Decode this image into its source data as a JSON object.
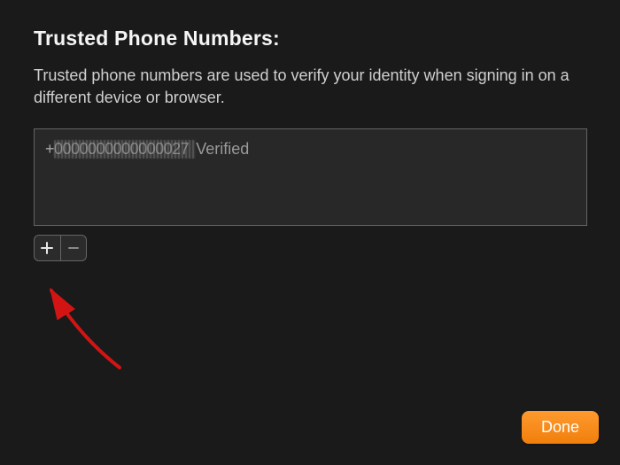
{
  "title": "Trusted Phone Numbers:",
  "description": "Trusted phone numbers are used to verify your identity when signing in on a different device or browser.",
  "phones": [
    {
      "masked_number": "+0000000000000027",
      "status": "Verified"
    }
  ],
  "buttons": {
    "add_label": "+",
    "remove_label": "−",
    "done_label": "Done"
  },
  "colors": {
    "accent": "#f28113",
    "annotation": "#d31414"
  }
}
